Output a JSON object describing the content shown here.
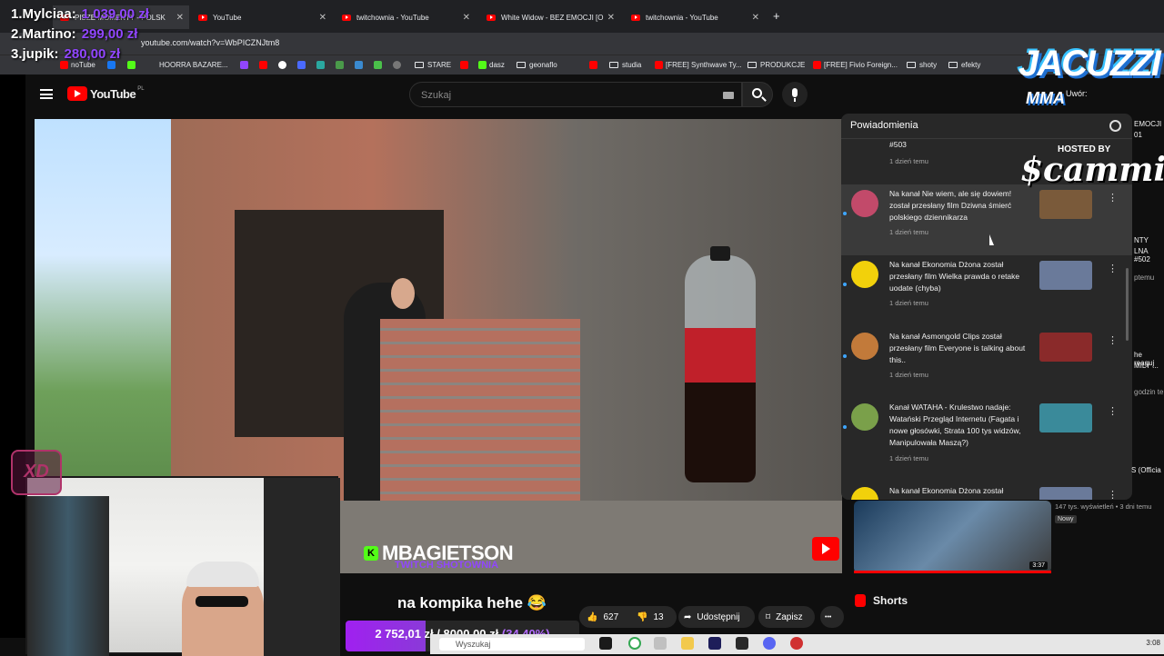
{
  "browser": {
    "tabs": [
      {
        "label": "PISZE MOMENTY - POLSK"
      },
      {
        "label": "YouTube"
      },
      {
        "label": "twitchownia - YouTube"
      },
      {
        "label": "White Widow - BEZ EMOCJI [O"
      },
      {
        "label": "twitchownia - YouTube"
      }
    ],
    "new_tab": "+",
    "url": "youtube.com/watch?v=WbPICZNJtm8",
    "bookmarks": [
      "noTube",
      "HOORRA BAZARE...",
      "STARE",
      "dasz",
      "geonaflo",
      "studia",
      "[FREE] Synthwave Ty...",
      "PRODUKCJE",
      "[FREE] Fivio Foreign...",
      "shoty",
      "efekty"
    ]
  },
  "youtube": {
    "logo_text": "YouTube",
    "logo_region": "PL",
    "search_placeholder": "Szukaj",
    "video_title": "na kompika hehe 😂",
    "like_count": "627",
    "dislike_count": "13",
    "share_label": "Udostępnij",
    "save_label": "Zapisz",
    "more_label": "•••",
    "sponsor_name": "MBAGIETSON",
    "sponsor_sub": "TWITCH SHOTOWNIA",
    "notifications": {
      "title": "Powiadomienia",
      "items": [
        {
          "text": "#503",
          "time": "1 dzień temu",
          "avatar_color": "#555555",
          "thumb_color": "#444444"
        },
        {
          "text": "Na kanał Nie wiem, ale się dowiem! został przesłany film Dziwna śmierć polskiego dziennikarza",
          "time": "1 dzień temu",
          "avatar_color": "#c24a6a",
          "thumb_color": "#7a5a3a"
        },
        {
          "text": "Na kanał Ekonomia Dżona został przesłany film Wielka prawda o retake uodate (chyba)",
          "time": "1 dzień temu",
          "avatar_color": "#f2d10b",
          "thumb_color": "#6a7a9a"
        },
        {
          "text": "Na kanał Asmongold Clips został przesłany film Everyone is talking about this..",
          "time": "1 dzień temu",
          "avatar_color": "#c27a3a",
          "thumb_color": "#8a2a2a"
        },
        {
          "text": "Kanał WATAHA - Krulestwo nadaje: Watański Przegląd Internetu (Fagata i nowe głosówki, Strata 100 tys widzów, Manipulowała Maszą?)",
          "time": "1 dzień temu",
          "avatar_color": "#7aa04a",
          "thumb_color": "#3a8a9a"
        },
        {
          "text": "Na kanał Ekonomia Dżona został",
          "time": "",
          "avatar_color": "#f2d10b",
          "thumb_color": "#6a7a9a"
        }
      ]
    },
    "short_duration": "3:37",
    "short_meta": "147 tys. wyświetleń • 3 dni temu",
    "short_badge": "Nowy",
    "shorts_label": "Shorts",
    "sidebar_fragments": [
      "EMOCJI",
      "01",
      "NTY",
      "LNA #502",
      "ptemu",
      "he reaguj",
      "MILY ...",
      "godzin te",
      "S (Officia"
    ]
  },
  "stream_overlay": {
    "leaderboard": [
      {
        "rank": "1.",
        "name": "Mylciaa:",
        "amount": "1 039,00 zł"
      },
      {
        "rank": "2.",
        "name": "Martino:",
        "amount": "299,00 zł"
      },
      {
        "rank": "3.",
        "name": "jupik:",
        "amount": "280,00 zł"
      }
    ],
    "logo_line1": "JACUZZI",
    "logo_line2": "MMA",
    "hosted_by": "HOSTED BY",
    "host_name": "$cammieZ",
    "xd_badge": "XD",
    "goal_current": "2 752,01 zł",
    "goal_sep": "/",
    "goal_target": "8000,00 zł",
    "goal_percent": "(34,40%)",
    "goal_fraction": 0.344,
    "watermark": "Uwór:"
  },
  "taskbar": {
    "search_placeholder": "Wyszukaj",
    "clock": "3:08"
  },
  "colors": {
    "yt_red": "#ff0000",
    "twitch_purple": "#9146ff",
    "kick_green": "#53fc18",
    "link_blue": "#3ea6ff"
  }
}
